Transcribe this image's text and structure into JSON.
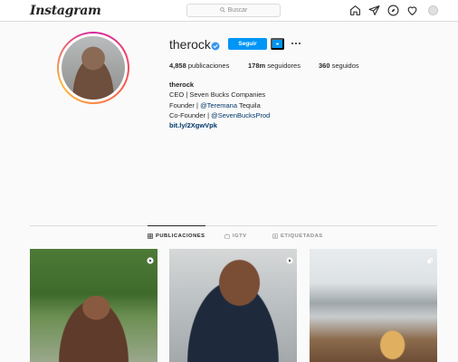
{
  "header": {
    "logo": "Instagram",
    "search_placeholder": "Buscar",
    "icons": [
      "home-icon",
      "direct-icon",
      "explore-icon",
      "activity-heart-icon",
      "profile-avatar"
    ]
  },
  "profile": {
    "username": "therock",
    "verified": true,
    "follow_label": "Seguir",
    "stats": {
      "posts_count": "4,858",
      "posts_label": "publicaciones",
      "followers_count": "178m",
      "followers_label": "seguidores",
      "following_count": "360",
      "following_label": "seguidos"
    },
    "bio": {
      "full_name": "therock",
      "line1": "CEO | Seven Bucks Companies",
      "line2_prefix": "Founder | ",
      "line2_mention": "@Teremana",
      "line2_suffix": " Tequila",
      "line3_prefix": "Co-Founder | ",
      "line3_mention": "@SevenBucksProd",
      "link": "bit.ly/2XgwVpk"
    }
  },
  "tabs": [
    {
      "label": "PUBLICACIONES",
      "icon": "grid-icon",
      "active": true
    },
    {
      "label": "IGTV",
      "icon": "igtv-icon",
      "active": false
    },
    {
      "label": "ETIQUETADAS",
      "icon": "tagged-icon",
      "active": false
    }
  ],
  "posts": [
    {
      "type": "video"
    },
    {
      "type": "video"
    },
    {
      "type": "carousel"
    }
  ],
  "colors": {
    "accent": "#0095f6",
    "link": "#00376b",
    "background": "#fafafa",
    "border": "#dbdbdb"
  }
}
